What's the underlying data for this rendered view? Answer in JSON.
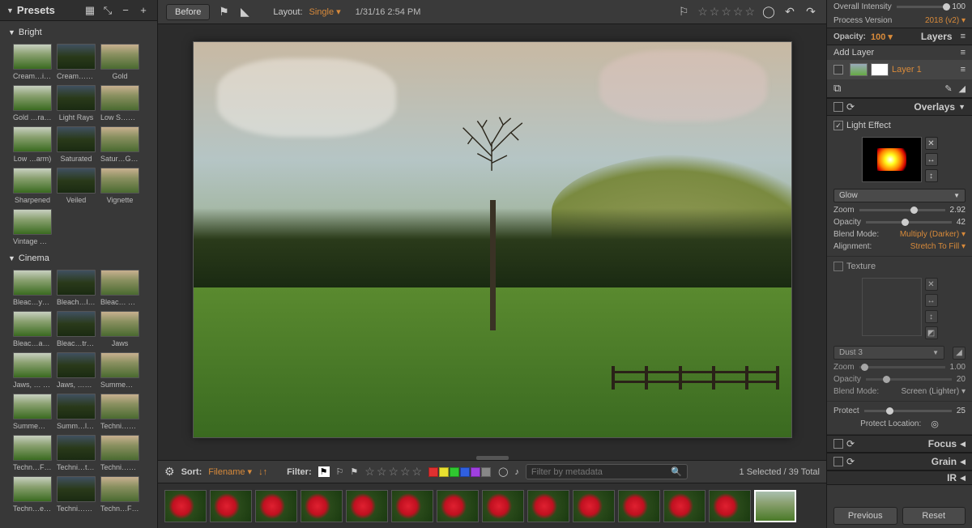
{
  "left": {
    "title": "Presets",
    "groups": [
      {
        "name": "Bright",
        "items": [
          "Cream…ights",
          "Cream…ette)",
          "Gold",
          "Gold …rame)",
          "Light Rays",
          "Low S…ation",
          "Low …arm)",
          "Saturated",
          "Satur…Glow)",
          "Sharpened",
          "Veiled",
          "Vignette",
          "Vintage Color"
        ]
      },
      {
        "name": "Cinema",
        "items": [
          "Bleac…ypass",
          "Bleach…lights",
          "Bleac… Cast",
          "Bleac…ation",
          "Bleac…trast",
          "Jaws",
          "Jaws, … Shift",
          "Jaws, …e Skin",
          "Summe…tion)",
          "Summe…tion)",
          "Summ…low)",
          "Techni…Strip)",
          "Techn…Faded",
          "Techni…tched",
          "Techni…nette",
          "Techn…ess 4",
          "Techni…grain)",
          "Techn…Faded"
        ]
      }
    ]
  },
  "center": {
    "before_btn": "Before",
    "layout_label": "Layout:",
    "layout_value": "Single",
    "timestamp": "1/31/16 2:54 PM",
    "sort_label": "Sort:",
    "sort_value": "Filename",
    "filter_label": "Filter:",
    "search_placeholder": "Filter by metadata",
    "count_text": "1 Selected / 39 Total",
    "filter_colors": [
      "#e03030",
      "#e8e030",
      "#30c830",
      "#3060e0",
      "#a040e0",
      "#888888"
    ]
  },
  "right": {
    "overall_intensity_label": "Overall Intensity",
    "overall_intensity_value": "100",
    "process_version_label": "Process Version",
    "process_version_value": "2018 (v2)",
    "opacity_label": "Opacity:",
    "opacity_value": "100",
    "layers_title": "Layers",
    "add_layer": "Add Layer",
    "layer_name": "Layer 1",
    "overlays_title": "Overlays",
    "light_effect_label": "Light Effect",
    "glow_label": "Glow",
    "le_zoom_label": "Zoom",
    "le_zoom_value": "2.92",
    "le_opacity_label": "Opacity",
    "le_opacity_value": "42",
    "blend_mode_label": "Blend Mode:",
    "le_blend_mode_value": "Multiply (Darker)",
    "alignment_label": "Alignment:",
    "alignment_value": "Stretch To Fill",
    "texture_label": "Texture",
    "texture_name": "Dust  3",
    "tx_zoom_label": "Zoom",
    "tx_zoom_value": "1.00",
    "tx_opacity_label": "Opacity",
    "tx_opacity_value": "20",
    "tx_blend_mode_value": "Screen (Lighter)",
    "protect_label": "Protect",
    "protect_value": "25",
    "protect_location_label": "Protect Location:",
    "focus_title": "Focus",
    "grain_title": "Grain",
    "ir_title": "IR",
    "previous_btn": "Previous",
    "reset_btn": "Reset"
  }
}
